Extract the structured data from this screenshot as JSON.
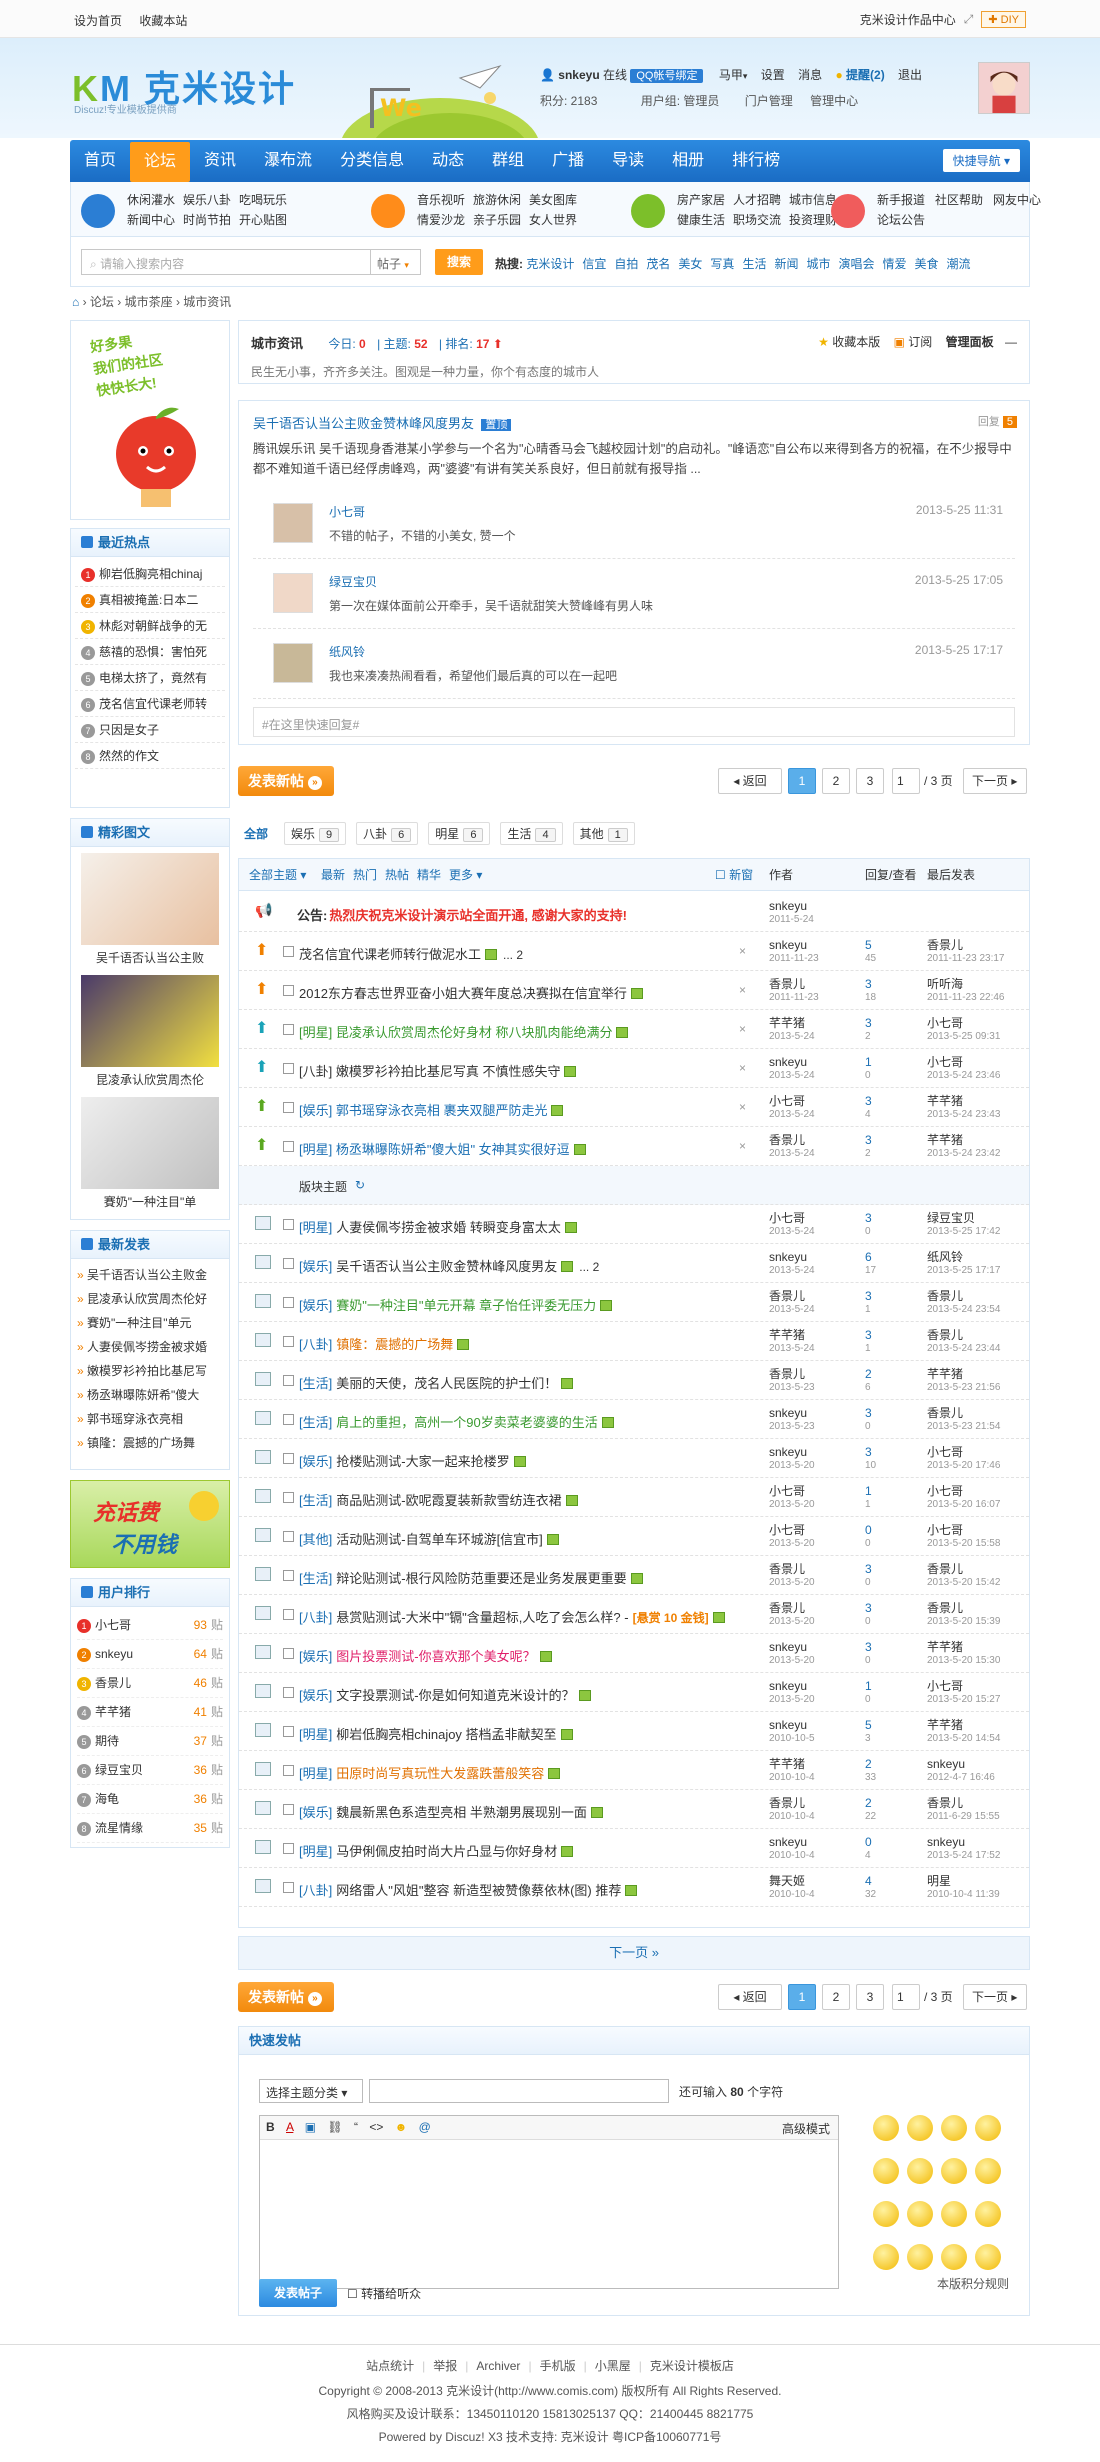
{
  "topbar": {
    "set_home": "设为首页",
    "bookmark": "收藏本站",
    "style_center": "克米设计作品中心",
    "diy": "DIY"
  },
  "header": {
    "logo_main": "克米设计",
    "logo_sub": "Discuz!专业模板提供商",
    "user": {
      "name": "snkeyu",
      "online": "在线",
      "qq_bind": "QQ帐号绑定",
      "horse": "马甲",
      "settings": "设置",
      "messages": "消息",
      "reminders": "提醒(2)",
      "logout": "退出",
      "credits": "积分: 2183",
      "group": "用户组: 管理员",
      "portal_admin": "门户管理",
      "admin_center": "管理中心"
    }
  },
  "nav": {
    "items": [
      "首页",
      "论坛",
      "资讯",
      "瀑布流",
      "分类信息",
      "动态",
      "群组",
      "广播",
      "导读",
      "相册",
      "排行榜"
    ],
    "quick": "快捷导航"
  },
  "subnav": {
    "groups": [
      {
        "links": [
          "休闲灌水",
          "娱乐八卦",
          "吃喝玩乐",
          "新闻中心",
          "时尚节拍",
          "开心贴图"
        ],
        "color": "#2b7ed4"
      },
      {
        "links": [
          "音乐视听",
          "旅游休闲",
          "美女图库",
          "情爱沙龙",
          "亲子乐园",
          "女人世界"
        ],
        "color": "#ff8c1a"
      },
      {
        "links": [
          "房产家居",
          "人才招聘",
          "城市信息",
          "健康生活",
          "职场交流",
          "投资理财"
        ],
        "color": "#7cbf2a"
      },
      {
        "links": [
          "新手报道",
          "社区帮助",
          "网友中心",
          "论坛公告"
        ],
        "color": "#f05c5c"
      }
    ]
  },
  "search": {
    "placeholder": "请输入搜索内容",
    "type": "帖子",
    "button": "搜索",
    "hot_label": "热搜:",
    "hot": [
      "克米设计",
      "信宜",
      "自拍",
      "茂名",
      "美女",
      "写真",
      "生活",
      "新闻",
      "城市",
      "演唱会",
      "情爱",
      "美食",
      "潮流"
    ]
  },
  "breadcrumb": [
    "论坛",
    "城市茶座",
    "城市资讯"
  ],
  "sidebar": {
    "ad_text": [
      "好多果",
      "我们的社区",
      "快快长大!"
    ],
    "hot_title": "最近热点",
    "hot": [
      "柳岩低胸亮相chinaj",
      "真相被掩盖:日本二",
      "林彪对朝鲜战争的无",
      "慈禧的恐惧：害怕死",
      "电梯太挤了，竟然有",
      "茂名信宜代课老师转",
      "只因是女子",
      "然然的作文"
    ],
    "pics_title": "精彩图文",
    "pics": [
      "吴千语否认当公主败",
      "昆凌承认欣赏周杰伦",
      "賽奶\"一种注目\"单"
    ],
    "new_title": "最新发表",
    "new": [
      "吴千语否认当公主败金",
      "昆凌承认欣赏周杰伦好",
      "賽奶\"一种注目\"单元",
      "人妻侯佩岑捞金被求婚",
      "嫩模罗衫衿拍比基尼写",
      "杨丞琳曝陈妍希\"傻大",
      "郭书瑶穿泳衣亮相",
      "镇隆：震撼的广场舞"
    ],
    "promo": [
      "充话费",
      "不用钱"
    ],
    "rank_title": "用户排行",
    "rank": [
      {
        "name": "小七哥",
        "n": "93"
      },
      {
        "name": "snkeyu",
        "n": "64"
      },
      {
        "name": "香景儿",
        "n": "46"
      },
      {
        "name": "芊芊猪",
        "n": "41"
      },
      {
        "name": "期待",
        "n": "37"
      },
      {
        "name": "绿豆宝贝",
        "n": "36"
      },
      {
        "name": "海龟",
        "n": "36"
      },
      {
        "name": "流星情缘",
        "n": "35"
      }
    ],
    "rank_unit": "贴"
  },
  "forum": {
    "name": "城市资讯",
    "today_label": "今日:",
    "today": "0",
    "topics_label": "主题:",
    "topics": "52",
    "rank_label": "排名:",
    "rank": "17",
    "fav": "收藏本版",
    "rss": "订阅",
    "manage": "管理面板",
    "desc": "民生无小事，齐齐多关注。图观是一种力量，你个有态度的城市人"
  },
  "feature": {
    "title": "吴千语否认当公主败金赞林峰风度男友",
    "tag": "置顶",
    "reply_label": "回复",
    "reply_count": "5",
    "body": "腾讯娱乐讯 吴千语现身香港某小学参与一个名为\"心晴香马会飞越校园计划\"的启动礼。\"峰语恋\"自公布以来得到各方的祝福，在不少报导中都不难知道千语已经俘虏峰鸡，两\"婆婆\"有讲有笑关系良好，但日前就有报导指 ...",
    "comments": [
      {
        "user": "小七哥",
        "text": "不错的帖子，不错的小美女, 赞一个",
        "time": "2013-5-25 11:31"
      },
      {
        "user": "绿豆宝贝",
        "text": "第一次在媒体面前公开牵手，吴千语就甜笑大赞峰峰有男人味",
        "time": "2013-5-25 17:05"
      },
      {
        "user": "纸风铃",
        "text": "我也来凑凑热闹看看，希望他们最后真的可以在一起吧",
        "time": "2013-5-25 17:17"
      }
    ],
    "quick_reply": "#在这里快速回复#"
  },
  "paging": {
    "post": "发表新帖",
    "back": "返回",
    "pages": [
      "1",
      "2",
      "3"
    ],
    "page_input": "1",
    "total": "/ 3 页",
    "next": "下一页"
  },
  "tabs": [
    {
      "label": "全部",
      "n": ""
    },
    {
      "label": "娱乐",
      "n": "9"
    },
    {
      "label": "八卦",
      "n": "6"
    },
    {
      "label": "明星",
      "n": "6"
    },
    {
      "label": "生活",
      "n": "4"
    },
    {
      "label": "其他",
      "n": "1"
    }
  ],
  "thead": {
    "all": "全部主题",
    "latest": "最新",
    "hot": "热门",
    "heat": "热帖",
    "digest": "精华",
    "more": "更多",
    "newwin": "新窗",
    "author": "作者",
    "reply_view": "回复/查看",
    "last": "最后发表"
  },
  "announce": {
    "prefix": "公告:",
    "text": "热烈庆祝克米设计演示站全面开通, 感谢大家的支持!",
    "author": "snkeyu",
    "date": "2011-5-24"
  },
  "sticky": [
    {
      "title": "茂名信宜代课老师转行做泥水工",
      "pages": "... 2",
      "author": "snkeyu",
      "date": "2011-11-23",
      "rep": "5",
      "view": "45",
      "last": "香景儿",
      "ltime": "2011-11-23 23:17",
      "icon": "up-orange"
    },
    {
      "title": "2012东方春志世界亚奋小姐大赛年度总决赛拟在信宜举行",
      "pages": "",
      "author": "香景儿",
      "date": "2011-11-23",
      "rep": "3",
      "view": "18",
      "last": "听听海",
      "ltime": "2011-11-23 22:46",
      "icon": "up-orange"
    },
    {
      "title": "[明星] 昆凌承认欣赏周杰伦好身材 称八块肌肉能绝满分",
      "pages": "",
      "author": "芊芊猪",
      "date": "2013-5-24",
      "rep": "3",
      "view": "2",
      "last": "小七哥",
      "ltime": "2013-5-25 09:31",
      "icon": "up-teal"
    },
    {
      "title": "[八卦] 嫩模罗衫衿拍比基尼写真 不慎性感失守",
      "pages": "",
      "author": "snkeyu",
      "date": "2013-5-24",
      "rep": "1",
      "view": "0",
      "last": "小七哥",
      "ltime": "2013-5-24 23:46",
      "icon": "up-teal"
    },
    {
      "title": "[娱乐] 郭书瑶穿泳衣亮相 裹夹双腿严防走光",
      "pages": "",
      "author": "小七哥",
      "date": "2013-5-24",
      "rep": "3",
      "view": "4",
      "last": "芊芊猪",
      "ltime": "2013-5-24 23:43",
      "icon": "up-green"
    },
    {
      "title": "[明星] 杨丞琳曝陈妍希\"傻大姐\" 女神其实很好逗",
      "pages": "",
      "author": "香景儿",
      "date": "2013-5-24",
      "rep": "3",
      "view": "2",
      "last": "芊芊猪",
      "ltime": "2013-5-24 23:42",
      "icon": "up-green"
    }
  ],
  "section_label": "版块主题",
  "topics": [
    {
      "tag": "[明星]",
      "title": "人妻侯佩岑捞金被求婚 转瞬变身富太太",
      "pages": "",
      "author": "小七哥",
      "date": "2013-5-24",
      "rep": "3",
      "view": "0",
      "last": "绿豆宝贝",
      "ltime": "2013-5-25 17:42",
      "color": "#333"
    },
    {
      "tag": "[娱乐]",
      "title": "吴千语否认当公主败金赞林峰风度男友",
      "pages": "... 2",
      "author": "snkeyu",
      "date": "2013-5-24",
      "rep": "6",
      "view": "17",
      "last": "纸风铃",
      "ltime": "2013-5-25 17:17",
      "color": "#333"
    },
    {
      "tag": "[娱乐]",
      "title": "賽奶\"一种注目\"单元开幕 章子怡任评委无压力",
      "pages": "",
      "author": "香景儿",
      "date": "2013-5-24",
      "rep": "3",
      "view": "1",
      "last": "香景儿",
      "ltime": "2013-5-24 23:54",
      "color": "#3a9a30"
    },
    {
      "tag": "[八卦]",
      "title": "镇隆：震撼的广场舞",
      "pages": "",
      "author": "芊芊猪",
      "date": "2013-5-24",
      "rep": "3",
      "view": "1",
      "last": "香景儿",
      "ltime": "2013-5-24 23:44",
      "color": "#e07000"
    },
    {
      "tag": "[生活]",
      "title": "美丽的天使，茂名人民医院的护士们！",
      "pages": "",
      "author": "香景儿",
      "date": "2013-5-23",
      "rep": "2",
      "view": "6",
      "last": "芊芊猪",
      "ltime": "2013-5-23 21:56",
      "color": "#333"
    },
    {
      "tag": "[生活]",
      "title": "肩上的重担，高州一个90岁卖菜老婆婆的生活",
      "pages": "",
      "author": "snkeyu",
      "date": "2013-5-23",
      "rep": "3",
      "view": "0",
      "last": "香景儿",
      "ltime": "2013-5-23 21:54",
      "color": "#3a9a30"
    },
    {
      "tag": "[娱乐]",
      "title": "抢楼贴测试-大家一起来抢楼罗",
      "pages": "",
      "author": "snkeyu",
      "date": "2013-5-20",
      "rep": "3",
      "view": "10",
      "last": "小七哥",
      "ltime": "2013-5-20 17:46",
      "color": "#333"
    },
    {
      "tag": "[生活]",
      "title": "商品贴测试-欧呢霞夏装新款雪纺连衣裙",
      "pages": "",
      "author": "小七哥",
      "date": "2013-5-20",
      "rep": "1",
      "view": "1",
      "last": "小七哥",
      "ltime": "2013-5-20 16:07",
      "color": "#333"
    },
    {
      "tag": "[其他]",
      "title": "活动贴测试-自驾单车环城游[信宜市]",
      "pages": "",
      "author": "小七哥",
      "date": "2013-5-20",
      "rep": "0",
      "view": "0",
      "last": "小七哥",
      "ltime": "2013-5-20 15:58",
      "color": "#333"
    },
    {
      "tag": "[生活]",
      "title": "辩论贴测试-根行风险防范重要还是业务发展更重要",
      "pages": "",
      "author": "香景儿",
      "date": "2013-5-20",
      "rep": "3",
      "view": "0",
      "last": "香景儿",
      "ltime": "2013-5-20 15:42",
      "color": "#333"
    },
    {
      "tag": "[八卦]",
      "title": "悬赏贴测试-大米中\"镉\"含量超标,人吃了会怎么样? -",
      "pages": "",
      "extra": "[悬赏 10 金钱]",
      "author": "香景儿",
      "date": "2013-5-20",
      "rep": "3",
      "view": "0",
      "last": "香景儿",
      "ltime": "2013-5-20 15:39",
      "color": "#333"
    },
    {
      "tag": "[娱乐]",
      "title": "图片投票测试-你喜欢那个美女呢？",
      "pages": "",
      "author": "snkeyu",
      "date": "2013-5-20",
      "rep": "3",
      "view": "0",
      "last": "芊芊猪",
      "ltime": "2013-5-20 15:30",
      "color": "#e0206a"
    },
    {
      "tag": "[娱乐]",
      "title": "文字投票测试-你是如何知道克米设计的？",
      "pages": "",
      "author": "snkeyu",
      "date": "2013-5-20",
      "rep": "1",
      "view": "0",
      "last": "小七哥",
      "ltime": "2013-5-20 15:27",
      "color": "#333"
    },
    {
      "tag": "[明星]",
      "title": "柳岩低胸亮相chinajoy 搭档孟非献契至",
      "pages": "",
      "author": "snkeyu",
      "date": "2010-10-5",
      "rep": "5",
      "view": "3",
      "last": "芊芊猪",
      "ltime": "2013-5-20 14:54",
      "color": "#333"
    },
    {
      "tag": "[明星]",
      "title": "田原时尚写真玩性大发露跌蕾般笑容",
      "pages": "",
      "author": "芊芊猪",
      "date": "2010-10-4",
      "rep": "2",
      "view": "33",
      "last": "snkeyu",
      "ltime": "2012-4-7 16:46",
      "color": "#e07000"
    },
    {
      "tag": "[娱乐]",
      "title": "魏晨新黑色系造型亮相 半熟潮男展现别一面",
      "pages": "",
      "author": "香景儿",
      "date": "2010-10-4",
      "rep": "2",
      "view": "22",
      "last": "香景儿",
      "ltime": "2011-6-29 15:55",
      "color": "#333"
    },
    {
      "tag": "[明星]",
      "title": "马伊俐佩皮拍时尚大片凸显与你好身材",
      "pages": "",
      "author": "snkeyu",
      "date": "2010-10-4",
      "rep": "0",
      "view": "4",
      "last": "snkeyu",
      "ltime": "2013-5-24 17:52",
      "color": "#333"
    },
    {
      "tag": "[八卦]",
      "title": "网络雷人\"风姐\"整容 新造型被赞像蔡依林(图) 推荐",
      "pages": "",
      "author": "舞天姬",
      "date": "2010-10-4",
      "rep": "4",
      "view": "32",
      "last": "明星",
      "ltime": "2010-10-4 11:39",
      "color": "#333"
    }
  ],
  "next_page": "下一页 »",
  "quick_post": {
    "title": "快速发帖",
    "category": "选择主题分类",
    "limit_prefix": "还可输入",
    "limit": "80",
    "limit_suffix": "个字符",
    "advanced": "高级模式",
    "submit": "发表帖子",
    "broadcast": "转播给听众",
    "rules": "本版积分规则"
  },
  "footer": {
    "links": [
      "站点统计",
      "举报",
      "Archiver",
      "手机版",
      "小黑屋",
      "克米设计模板店"
    ],
    "copyright": "Copyright © 2008-2013 克米设计(http://www.comis.com) 版权所有 All Rights Reserved.",
    "contact": "风格购买及设计联系：13450110120 15813025137 QQ：21400445 8821775",
    "powered": "Powered by Discuz! X3  技术支持: 克米设计  粤ICP备10060771号"
  }
}
